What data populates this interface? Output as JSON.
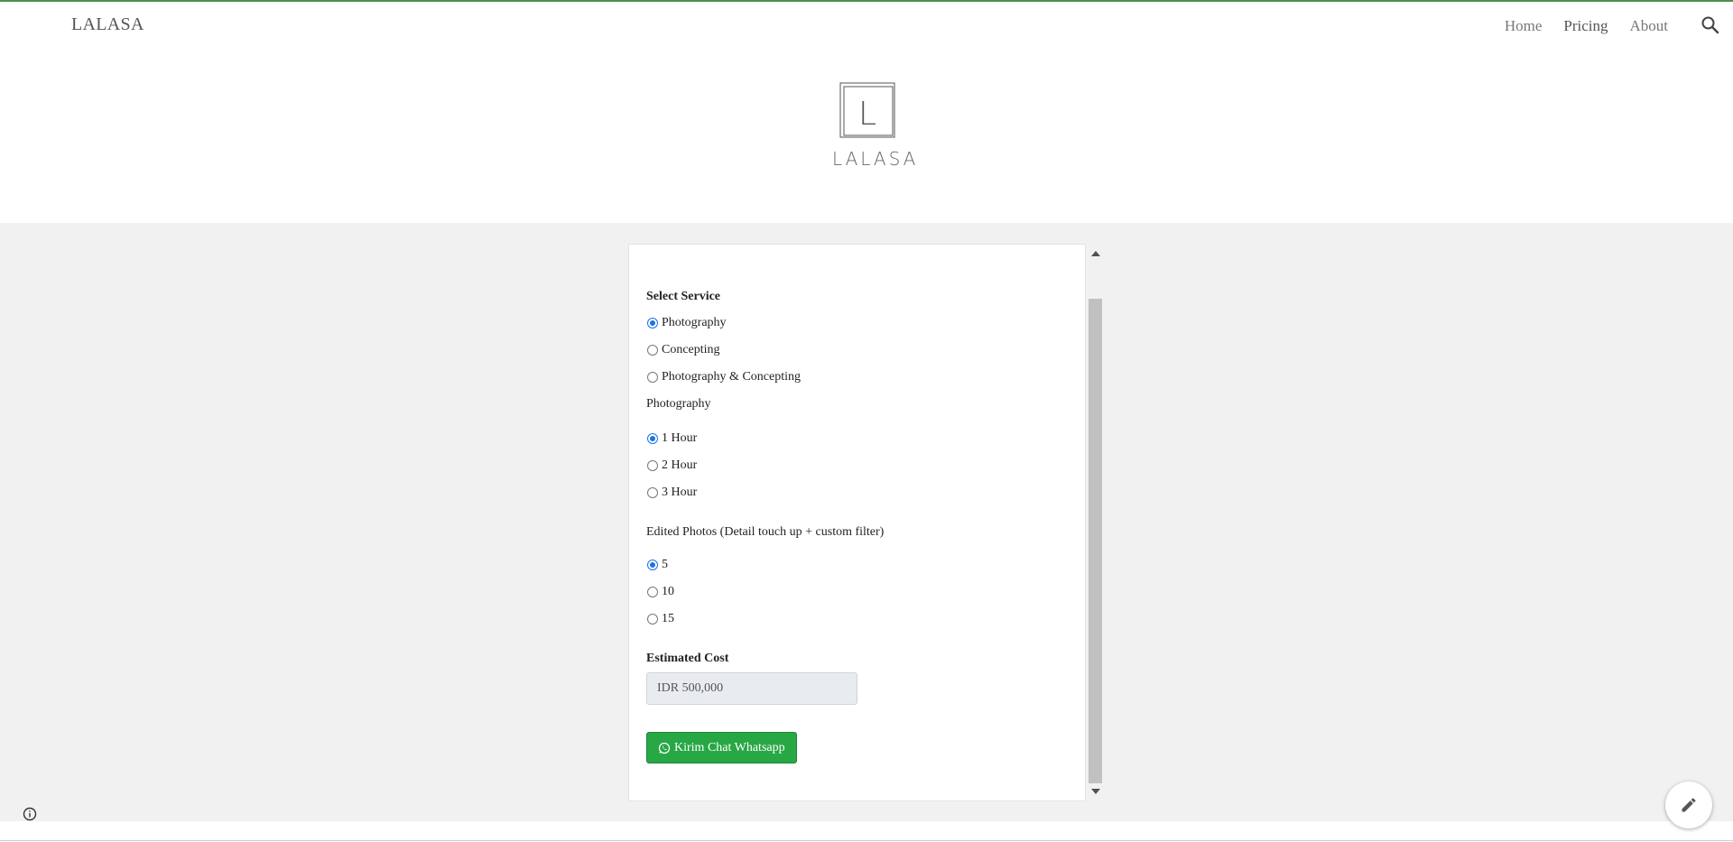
{
  "header": {
    "site_title": "LALASA",
    "nav": [
      "Home",
      "Pricing",
      "About"
    ],
    "active_nav": "Pricing",
    "search_icon": "search-icon"
  },
  "logo": {
    "letter": "L",
    "word": "LALASA"
  },
  "form": {
    "service_label": "Select Service",
    "services": [
      {
        "label": "Photography",
        "checked": true
      },
      {
        "label": "Concepting",
        "checked": false
      },
      {
        "label": "Photography & Concepting",
        "checked": false
      }
    ],
    "photography_label": "Photography",
    "durations": [
      {
        "label": "1 Hour",
        "checked": true
      },
      {
        "label": "2 Hour",
        "checked": false
      },
      {
        "label": "3 Hour",
        "checked": false
      }
    ],
    "edited_label": "Edited Photos (Detail touch up + custom filter)",
    "edited_options": [
      {
        "label": "5",
        "checked": true
      },
      {
        "label": "10",
        "checked": false
      },
      {
        "label": "15",
        "checked": false
      }
    ],
    "cost_label": "Estimated Cost",
    "cost_value": "IDR 500,000",
    "whatsapp_button": "Kirim Chat Whatsapp"
  },
  "colors": {
    "accent_green": "#28a745",
    "radio_blue": "#1a73e8",
    "top_line": "#4c8f4c"
  }
}
